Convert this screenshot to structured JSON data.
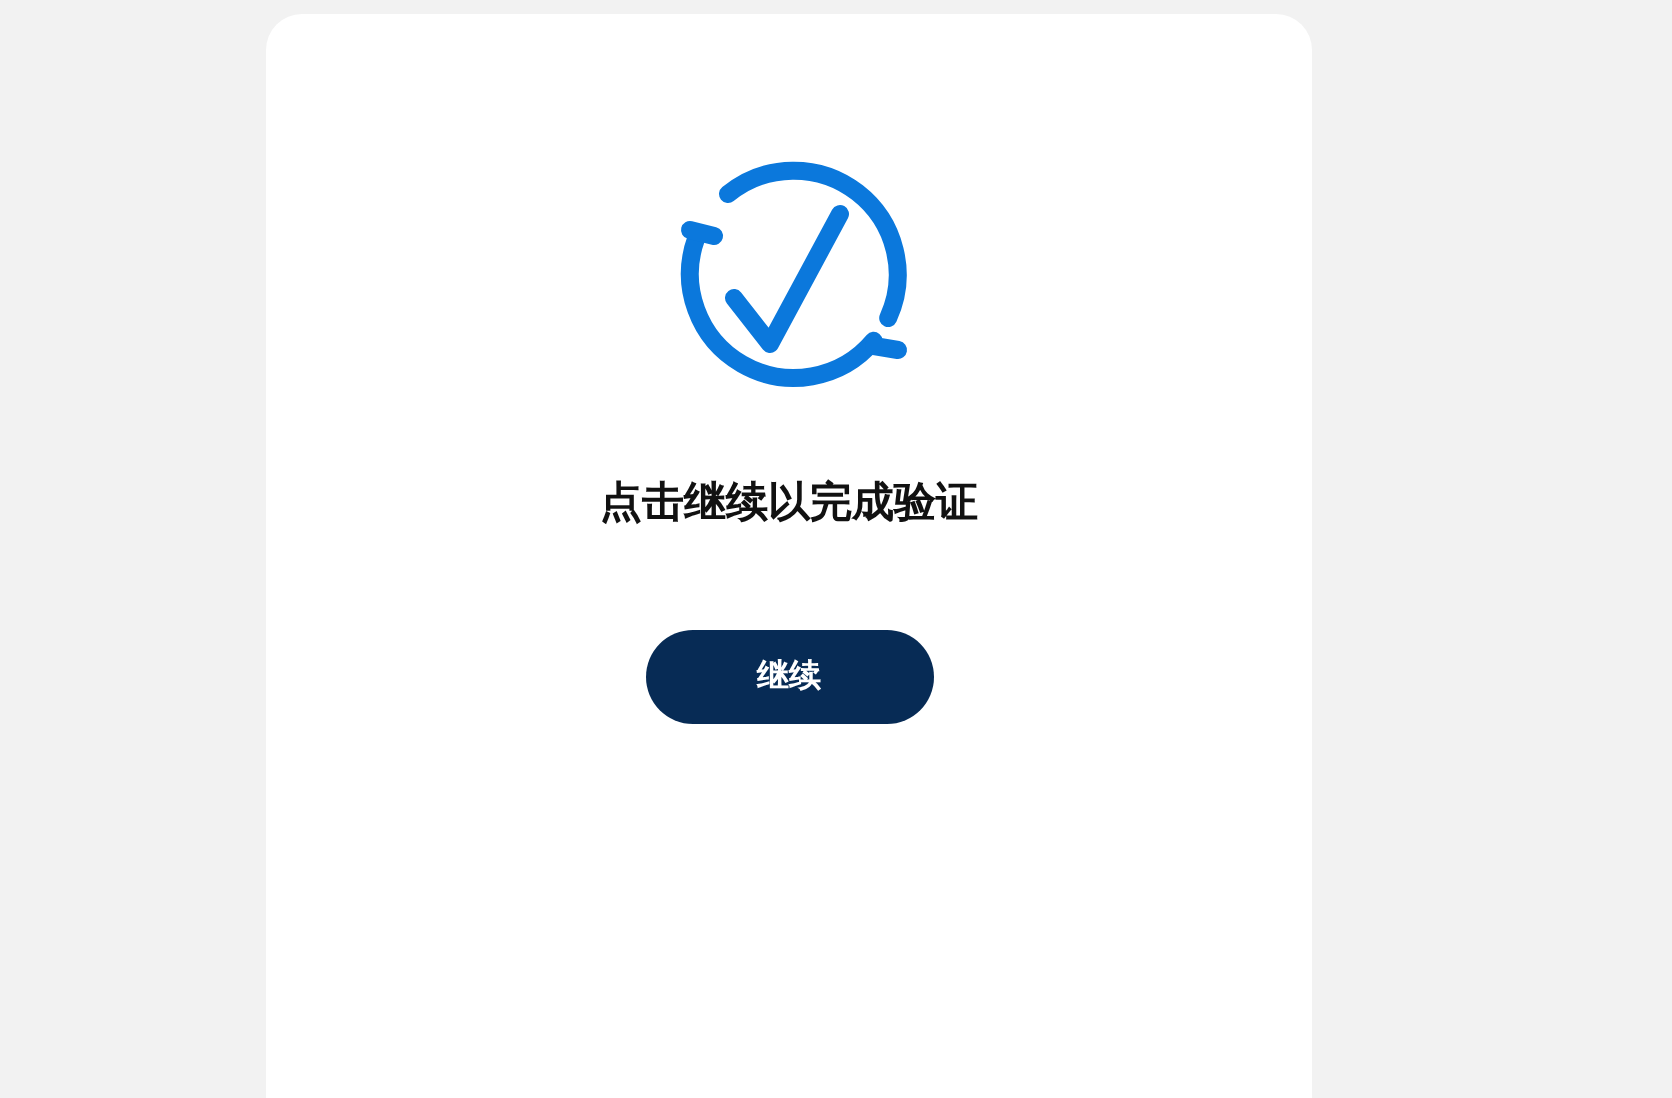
{
  "prompt": "点击继续以完成验证",
  "button": {
    "label": "继续"
  }
}
